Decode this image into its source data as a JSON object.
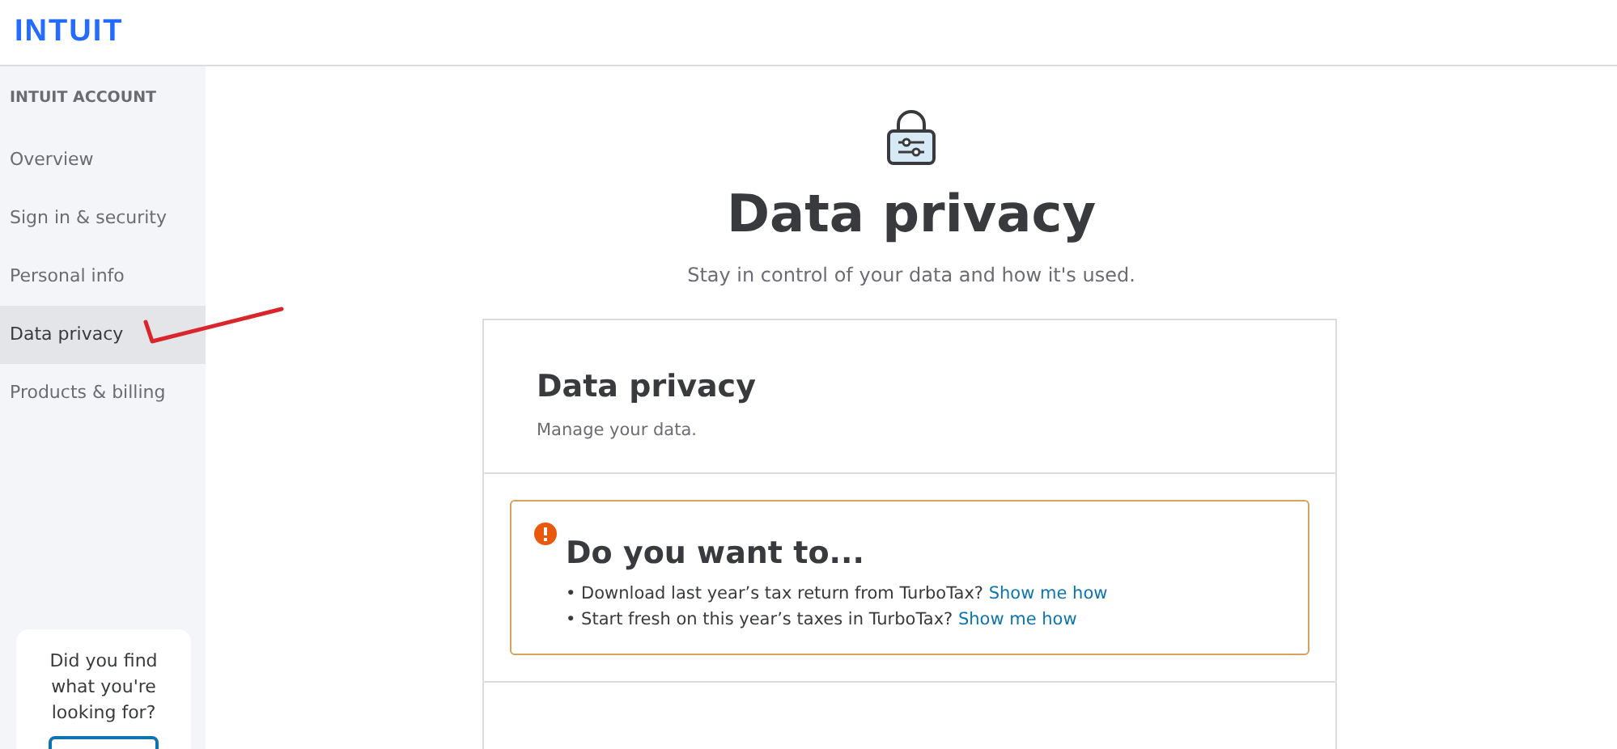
{
  "header": {
    "logo": "INTUIT"
  },
  "sidebar": {
    "heading": "INTUIT ACCOUNT",
    "items": [
      {
        "label": "Overview",
        "selected": false
      },
      {
        "label": "Sign in & security",
        "selected": false
      },
      {
        "label": "Personal info",
        "selected": false
      },
      {
        "label": "Data privacy",
        "selected": true
      },
      {
        "label": "Products & billing",
        "selected": false
      }
    ],
    "feedback": {
      "question": "Did you find what you're looking for?"
    }
  },
  "page": {
    "title": "Data privacy",
    "subtitle": "Stay in control of your data and how it's used."
  },
  "card": {
    "title": "Data privacy",
    "subtitle": "Manage your data.",
    "alert": {
      "title": "Do you want to...",
      "items": [
        {
          "text": "• Download last year’s tax return from TurboTax?",
          "link": "Show me how"
        },
        {
          "text": "• Start fresh on this year’s taxes in TurboTax?",
          "link": "Show me how"
        }
      ]
    }
  }
}
